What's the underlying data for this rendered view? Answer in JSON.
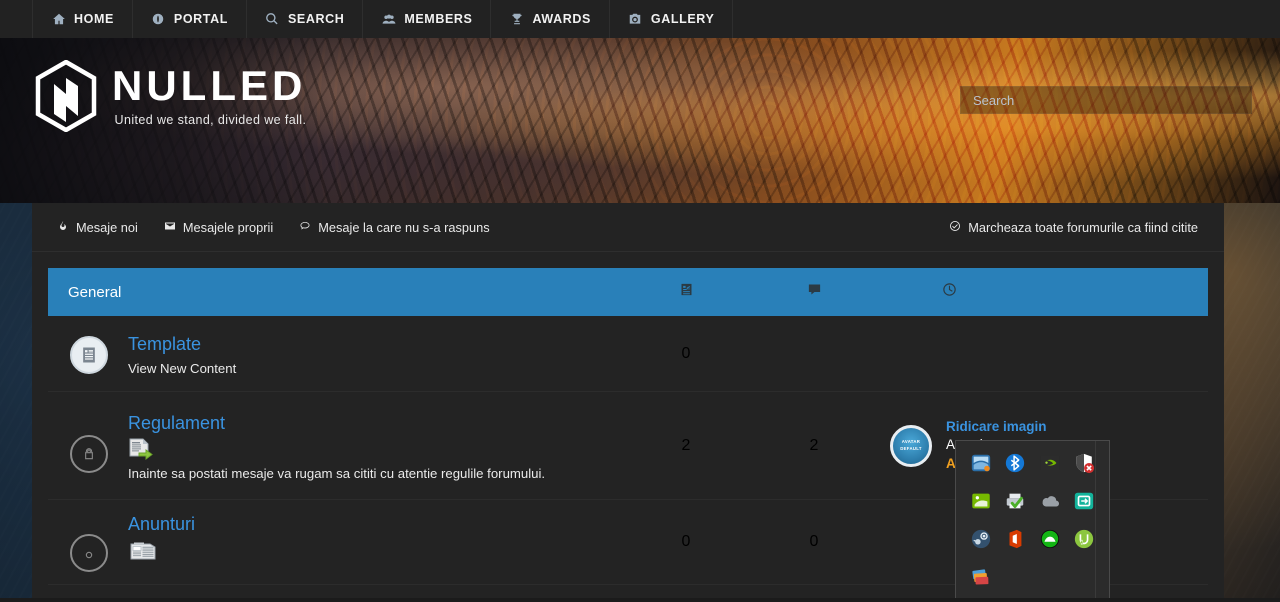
{
  "topnav": {
    "items": [
      {
        "label": "HOME",
        "icon": "home-icon"
      },
      {
        "label": "PORTAL",
        "icon": "portal-icon"
      },
      {
        "label": "SEARCH",
        "icon": "search-icon"
      },
      {
        "label": "MEMBERS",
        "icon": "members-icon"
      },
      {
        "label": "AWARDS",
        "icon": "trophy-icon"
      },
      {
        "label": "GALLERY",
        "icon": "camera-icon"
      }
    ]
  },
  "hero": {
    "brand": "NULLED",
    "tagline": "United we stand, divided we fall.",
    "search": {
      "value": "",
      "placeholder": "Search"
    }
  },
  "subnav": {
    "links": [
      {
        "label": "Mesaje noi",
        "icon": "flame-icon"
      },
      {
        "label": "Mesajele proprii",
        "icon": "envelope-icon"
      },
      {
        "label": "Mesaje la care nu s-a raspuns",
        "icon": "speech-bubble-icon"
      }
    ],
    "mark_read": {
      "label": "Marcheaza toate forumurile ca fiind citite",
      "icon": "check-circle-icon"
    }
  },
  "forum": {
    "category": "General",
    "columns": [
      {
        "name": "topics-column",
        "icon": "document-lines-icon"
      },
      {
        "name": "replies-column",
        "icon": "comment-icon"
      },
      {
        "name": "lastpost-column",
        "icon": "clock-icon"
      }
    ],
    "accent": "#2980b9",
    "link_color": "#3a93e0",
    "rows": [
      {
        "status_icon": "read-document-badge",
        "name": "Template",
        "desc": "View New Content",
        "sub_icon": "",
        "topics": "0",
        "replies": "",
        "last_post": null
      },
      {
        "status_icon": "locked-forum-badge",
        "name": "Regulament",
        "desc": "Inainte sa postati mesaje va rugam sa cititi cu atentie regulile forumului.",
        "sub_icon": "document-export-icon",
        "topics": "2",
        "replies": "2",
        "last_post": {
          "avatar_text_line1": "AVATAR",
          "avatar_text_line2": "DEFAULT",
          "title": "Ridicare imagin",
          "when": "Astazi",
          "author": "Admin"
        }
      },
      {
        "status_icon": "unread-forum-badge",
        "name": "Anunturi",
        "desc": "",
        "sub_icon": "newspaper-icon",
        "topics": "0",
        "replies": "0",
        "last_post": null
      }
    ]
  },
  "tray": {
    "icons": [
      "network-icon",
      "bluetooth-icon",
      "nvidia-icon",
      "security-shield-error-icon",
      "nvidia-geforce-experience-icon",
      "printer-ready-icon",
      "onedrive-icon",
      "remote-desktop-icon",
      "steam-icon",
      "microsoft-office-icon",
      "mega-sync-icon",
      "utorrent-icon",
      "card-stack-icon"
    ]
  }
}
